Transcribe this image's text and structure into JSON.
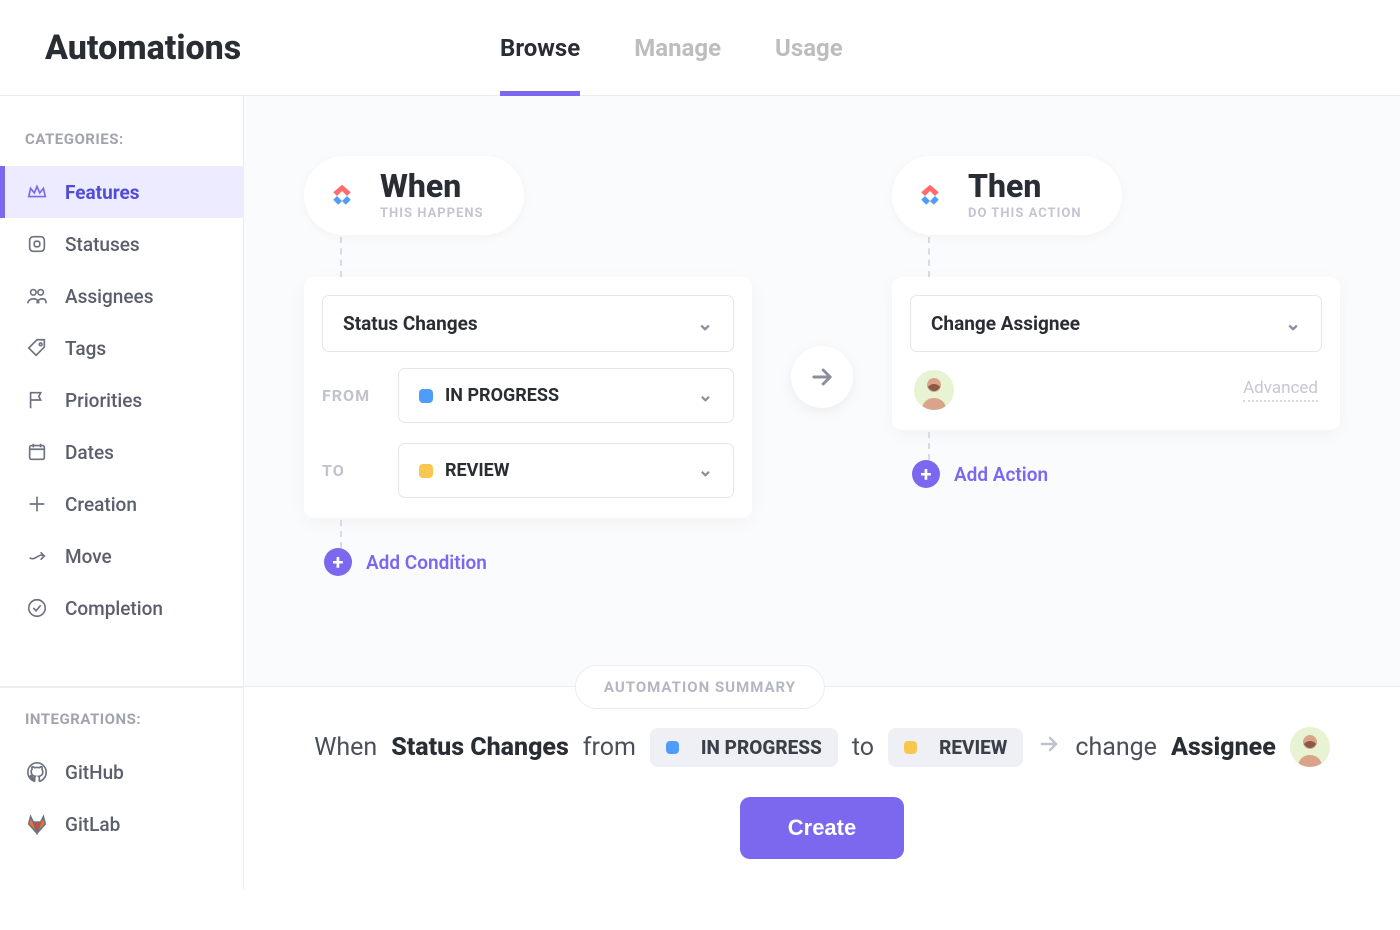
{
  "header": {
    "title": "Automations",
    "tabs": [
      {
        "label": "Browse",
        "active": true
      },
      {
        "label": "Manage",
        "active": false
      },
      {
        "label": "Usage",
        "active": false
      }
    ]
  },
  "sidebar": {
    "categories_heading": "CATEGORIES:",
    "integrations_heading": "INTEGRATIONS:",
    "items": [
      {
        "label": "Features",
        "icon": "crown-icon",
        "active": true
      },
      {
        "label": "Statuses",
        "icon": "square-icon",
        "active": false
      },
      {
        "label": "Assignees",
        "icon": "people-icon",
        "active": false
      },
      {
        "label": "Tags",
        "icon": "tag-icon",
        "active": false
      },
      {
        "label": "Priorities",
        "icon": "flag-icon",
        "active": false
      },
      {
        "label": "Dates",
        "icon": "calendar-icon",
        "active": false
      },
      {
        "label": "Creation",
        "icon": "plus-icon",
        "active": false
      },
      {
        "label": "Move",
        "icon": "arrow-icon",
        "active": false
      },
      {
        "label": "Completion",
        "icon": "check-icon",
        "active": false
      }
    ],
    "integrations": [
      {
        "label": "GitHub",
        "icon": "github-icon"
      },
      {
        "label": "GitLab",
        "icon": "gitlab-icon"
      }
    ]
  },
  "automation": {
    "when": {
      "title": "When",
      "subtitle": "THIS HAPPENS",
      "trigger": "Status Changes",
      "from_label": "FROM",
      "to_label": "TO",
      "from": {
        "name": "IN PROGRESS",
        "color": "#4f9cf9"
      },
      "to": {
        "name": "REVIEW",
        "color": "#f9c74f"
      },
      "add_condition_label": "Add Condition"
    },
    "then": {
      "title": "Then",
      "subtitle": "DO THIS ACTION",
      "action": "Change Assignee",
      "advanced_label": "Advanced",
      "add_action_label": "Add Action"
    }
  },
  "summary": {
    "badge": "AUTOMATION SUMMARY",
    "when_word": "When",
    "trigger": "Status Changes",
    "from_word": "from",
    "from_status": "IN PROGRESS",
    "to_word": "to",
    "to_status": "REVIEW",
    "action_word": "change",
    "action_target": "Assignee",
    "create_label": "Create"
  },
  "colors": {
    "accent": "#7b68ee",
    "in_progress": "#4f9cf9",
    "review": "#f9c74f"
  }
}
